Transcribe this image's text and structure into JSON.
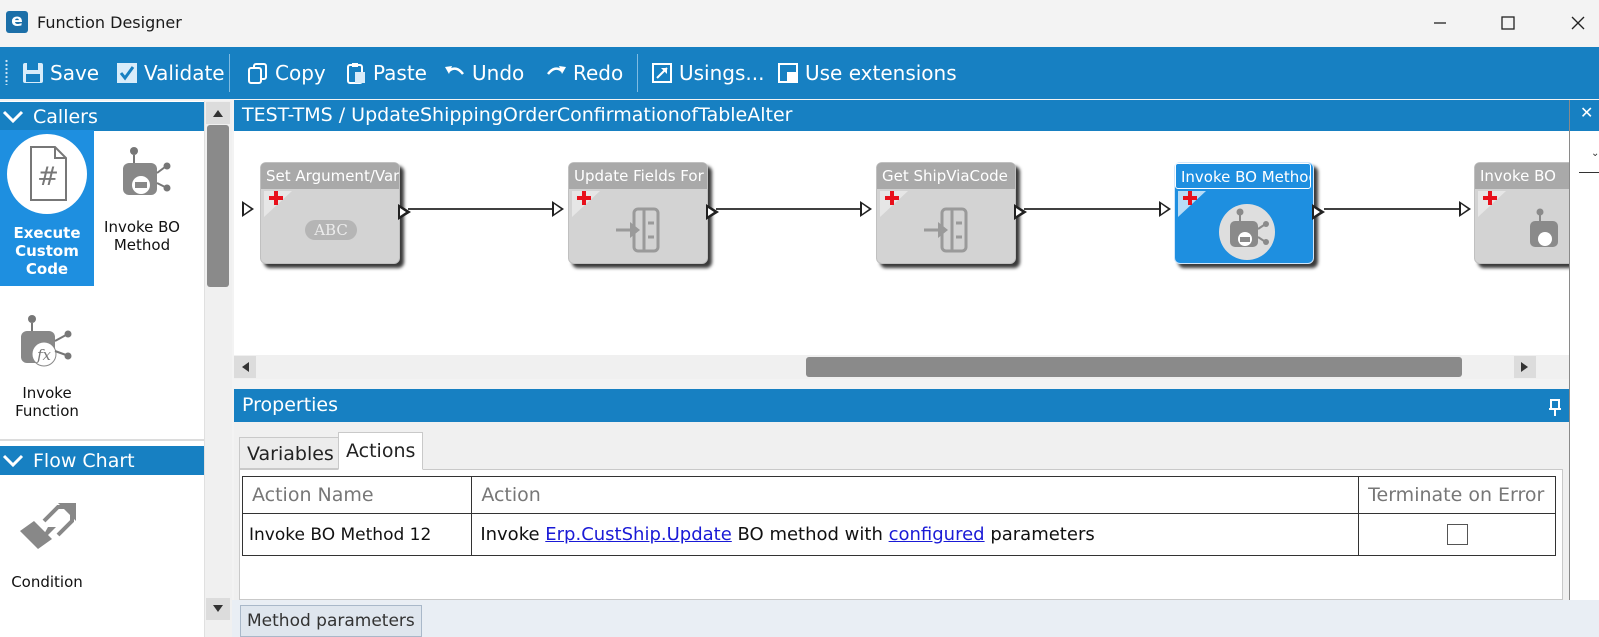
{
  "window": {
    "logo_letter": "e",
    "title": "Function Designer"
  },
  "toolbar": {
    "save": "Save",
    "validate": "Validate",
    "copy": "Copy",
    "paste": "Paste",
    "undo": "Undo",
    "redo": "Redo",
    "usings": "Usings...",
    "use_extensions": "Use extensions"
  },
  "left_panel": {
    "callers_title": "Callers",
    "flow_chart_title": "Flow Chart",
    "tools": {
      "execute_custom_code": "Execute Custom Code",
      "invoke_bo_method": "Invoke BO Method",
      "invoke_function": "Invoke Function",
      "condition": "Condition"
    }
  },
  "designer": {
    "breadcrumb": "TEST-TMS / UpdateShippingOrderConfirmationofTableAlter",
    "nodes": [
      {
        "title": "Set Argument/Vari",
        "icon": "abc-icon",
        "selected": false
      },
      {
        "title": "Update Fields For S",
        "icon": "update-fields-icon",
        "selected": false
      },
      {
        "title": "Get ShipViaCode",
        "icon": "update-fields-icon",
        "selected": false
      },
      {
        "title": "Invoke BO Method",
        "icon": "invoke-bo-icon",
        "selected": true
      },
      {
        "title": "Invoke BO",
        "icon": "invoke-bo-icon",
        "selected": false
      }
    ],
    "abc_label": "ABC"
  },
  "properties": {
    "title": "Properties",
    "tabs": {
      "variables": "Variables",
      "actions": "Actions"
    },
    "table": {
      "headers": {
        "action_name": "Action Name",
        "action": "Action",
        "terminate_on_error": "Terminate on Error"
      },
      "rows": [
        {
          "action_name": "Invoke BO Method 12",
          "action_prefix": "Invoke ",
          "bo_link": "Erp.CustShip.Update",
          "action_middle": " BO method with ",
          "params_link": "configured",
          "action_suffix": " parameters",
          "terminate_on_error": false
        }
      ]
    },
    "bottom_tab": "Method parameters"
  },
  "colors": {
    "accent": "#1780c2",
    "selected": "#1e8fe0",
    "node_gray": "#d3d3d3"
  }
}
